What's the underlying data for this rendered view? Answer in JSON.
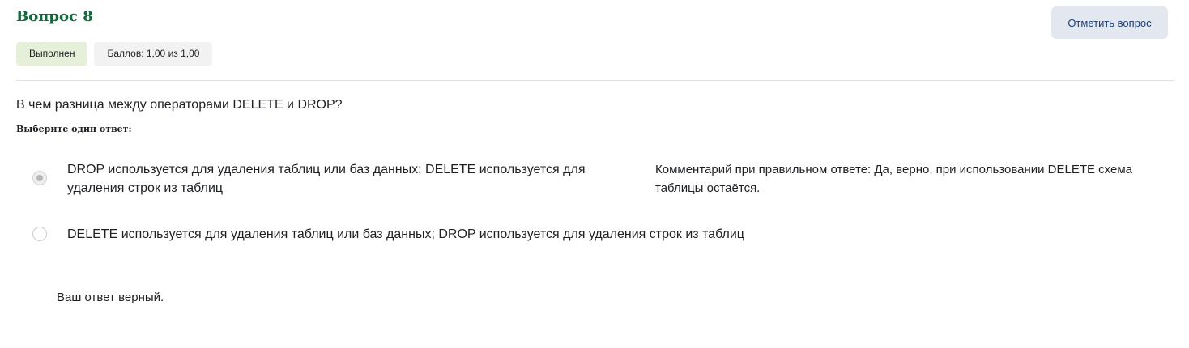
{
  "question": {
    "title": "Вопрос 8",
    "state": "Выполнен",
    "grade": "Баллов: 1,00 из 1,00",
    "flag_label": "Отметить вопрос",
    "text": "В чем разница между операторами DELETE и DROP?",
    "prompt": "Выберите один ответ:",
    "answers": [
      {
        "label": "DROP используется для удаления таблиц или баз данных; DELETE используется для удаления строк из таблиц",
        "selected": true,
        "feedback": "Комментарий при правильном ответе: Да, верно, при использовании DELETE схема таблицы остаётся."
      },
      {
        "label": "DELETE используется для удаления таблиц или баз данных; DROP используется для удаления строк из таблиц",
        "selected": false
      }
    ],
    "result": "Ваш ответ верный."
  },
  "colors": {
    "title": "#0f6b3c",
    "state_badge_bg": "#e6efda",
    "grade_badge_bg": "#f2f2f2",
    "flag_button_bg": "#e3e7f0",
    "flag_button_text": "#1b3f7a"
  }
}
